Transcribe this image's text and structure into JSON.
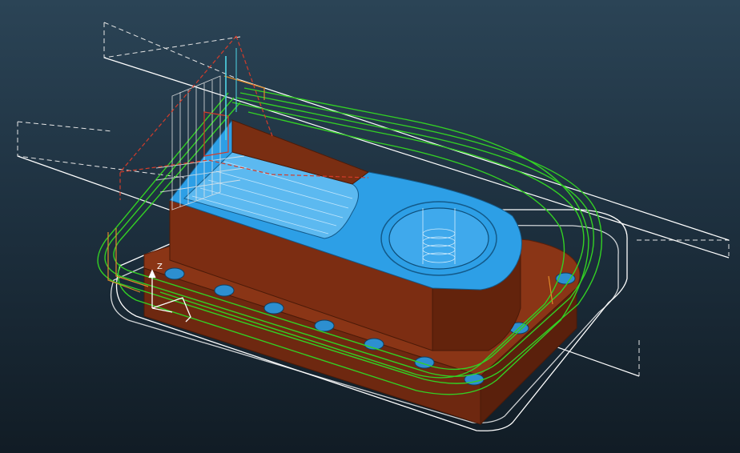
{
  "viewport": {
    "background_top": "#2b4456",
    "background_bottom": "#111c25"
  },
  "colors": {
    "toolpath_green": "#33d024",
    "toolpath_orange": "#e08a2a",
    "stock_outline": "#ffffff",
    "part_blue": "#2d9fe6",
    "part_brown": "#7a2e12",
    "tool_red": "#d43c2a",
    "tool_cyan": "#4fd6e6"
  },
  "triad": {
    "z_label": "Z"
  },
  "icons": [
    "cnc-part-icon",
    "tool-holder-icon",
    "axis-triad-icon"
  ]
}
